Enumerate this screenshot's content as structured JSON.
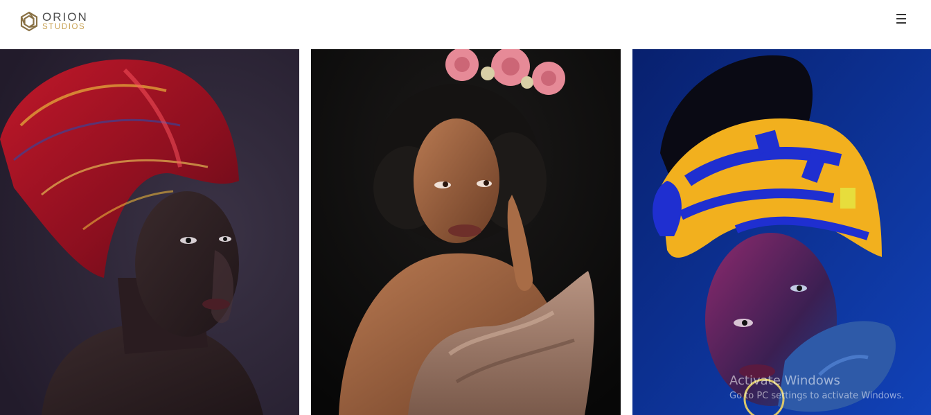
{
  "header": {
    "logo": {
      "word": "ORION",
      "sub": "STUDIOS",
      "mark_icon": "hexagon-logo-icon"
    },
    "menu_icon": "hamburger-menu-icon",
    "menu_glyph": "☰"
  },
  "gallery": {
    "photos": [
      {
        "subject": "woman in red patterned head wrap"
      },
      {
        "subject": "woman with pink flower crown"
      },
      {
        "subject": "woman in blue and yellow head wrap"
      }
    ]
  },
  "os_watermark": {
    "title": "Activate Windows",
    "subtitle": "Go to PC settings to activate Windows."
  },
  "colors": {
    "logo_text": "#4d4d4d",
    "logo_accent": "#c9a253",
    "photo1_bg": "#2e2638",
    "photo2_bg": "#111111",
    "photo3_bg": "#0b2a86"
  }
}
